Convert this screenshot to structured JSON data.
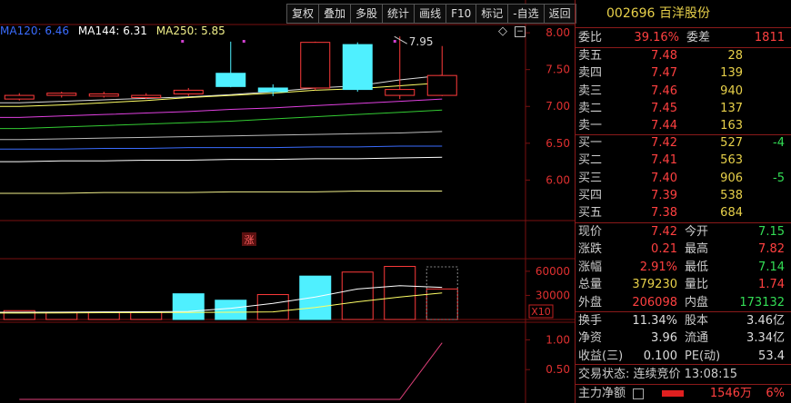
{
  "toolbar": [
    "复权",
    "叠加",
    "多股",
    "统计",
    "画线",
    "F10",
    "标记",
    "-自选",
    "返回"
  ],
  "ma_legend": {
    "ma120": "MA120: 6.46",
    "ma144": "MA144: 6.31",
    "ma250": "MA250: 5.85"
  },
  "colors": {
    "up": "#ff3b3b",
    "down": "#4ff0ff",
    "ma120": "#3a6cff",
    "ma144": "#ffffff",
    "ma250": "#f2f08a",
    "grid": "#7a1010"
  },
  "chart_data": [
    {
      "type": "candlestick",
      "ylim": [
        5.45,
        8.1
      ],
      "y_ticks": [
        "8.00",
        "7.50",
        "7.00",
        "6.50",
        "6.00"
      ],
      "annotations": [
        "7.95",
        "涨"
      ],
      "candles": [
        {
          "o": 7.1,
          "c": 7.15,
          "h": 7.18,
          "l": 7.08
        },
        {
          "o": 7.15,
          "c": 7.18,
          "h": 7.2,
          "l": 7.12
        },
        {
          "o": 7.14,
          "c": 7.17,
          "h": 7.2,
          "l": 7.12
        },
        {
          "o": 7.12,
          "c": 7.15,
          "h": 7.18,
          "l": 7.1
        },
        {
          "o": 7.17,
          "c": 7.22,
          "h": 7.25,
          "l": 7.14
        },
        {
          "o": 7.45,
          "c": 7.27,
          "h": 7.88,
          "l": 7.26
        },
        {
          "o": 7.25,
          "c": 7.2,
          "h": 7.3,
          "l": 7.14
        },
        {
          "o": 7.25,
          "c": 7.87,
          "h": 7.88,
          "l": 7.22
        },
        {
          "o": 7.84,
          "c": 7.23,
          "h": 7.87,
          "l": 7.2
        },
        {
          "o": 7.15,
          "c": 7.23,
          "h": 7.95,
          "l": 7.1
        },
        {
          "o": 7.15,
          "c": 7.42,
          "h": 7.82,
          "l": 7.14
        }
      ],
      "ma_lines": [
        {
          "color": "#d9d9d9",
          "values": [
            7.05,
            7.07,
            7.09,
            7.11,
            7.13,
            7.16,
            7.2,
            7.25,
            7.28,
            7.36,
            7.42
          ]
        },
        {
          "color": "#ffff66",
          "values": [
            7.0,
            7.02,
            7.05,
            7.08,
            7.12,
            7.15,
            7.18,
            7.22,
            7.24,
            7.28,
            7.32
          ]
        },
        {
          "color": "#e040e0",
          "values": [
            6.85,
            6.87,
            6.89,
            6.91,
            6.93,
            6.96,
            6.98,
            7.01,
            7.04,
            7.07,
            7.1
          ]
        },
        {
          "color": "#33cc33",
          "values": [
            6.7,
            6.72,
            6.74,
            6.76,
            6.78,
            6.8,
            6.83,
            6.86,
            6.89,
            6.92,
            6.95
          ]
        },
        {
          "color": "#bbbbbb",
          "values": [
            6.55,
            6.56,
            6.57,
            6.58,
            6.59,
            6.6,
            6.61,
            6.62,
            6.63,
            6.64,
            6.66
          ]
        },
        {
          "color": "#3a6cff",
          "values": [
            6.42,
            6.42,
            6.43,
            6.43,
            6.44,
            6.44,
            6.44,
            6.45,
            6.45,
            6.46,
            6.46
          ]
        },
        {
          "color": "#ffffff",
          "values": [
            6.25,
            6.26,
            6.26,
            6.27,
            6.27,
            6.28,
            6.28,
            6.29,
            6.29,
            6.3,
            6.31
          ]
        },
        {
          "color": "#f2f08a",
          "values": [
            5.82,
            5.82,
            5.83,
            5.83,
            5.83,
            5.84,
            5.84,
            5.84,
            5.85,
            5.85,
            5.85
          ]
        }
      ]
    },
    {
      "type": "bar",
      "ylim": [
        0,
        70000
      ],
      "y_ticks": [
        "60000",
        "30000"
      ],
      "unit_label": "X10",
      "values": [
        11000,
        9000,
        9000,
        9000,
        32000,
        24000,
        31000,
        54000,
        59000,
        66000,
        38000
      ],
      "directions": [
        "up",
        "up",
        "up",
        "up",
        "down",
        "down",
        "up",
        "down",
        "up",
        "up",
        "up"
      ],
      "ma_lines": [
        {
          "color": "#ffffff",
          "values": [
            9000,
            9200,
            9400,
            9600,
            10000,
            14000,
            20000,
            28000,
            38000,
            42000,
            40000
          ]
        },
        {
          "color": "#ffff66",
          "values": [
            8000,
            8200,
            8400,
            8600,
            8800,
            9000,
            9500,
            15000,
            22000,
            28000,
            33000
          ]
        }
      ]
    },
    {
      "type": "line",
      "ylim": [
        0,
        1.25
      ],
      "y_ticks": [
        "1.00",
        "0.50"
      ],
      "values": [
        0,
        0,
        0,
        0,
        0,
        0,
        0,
        0,
        0,
        0,
        0.95
      ]
    }
  ],
  "quote": {
    "code": "002696",
    "name": "百洋股份",
    "weibi_label": "委比",
    "weibi": "39.16%",
    "weicha_label": "委差",
    "weicha": "1811",
    "sells": [
      {
        "label": "卖五",
        "price": "7.48",
        "vol": "28",
        "chg": ""
      },
      {
        "label": "卖四",
        "price": "7.47",
        "vol": "139",
        "chg": ""
      },
      {
        "label": "卖三",
        "price": "7.46",
        "vol": "940",
        "chg": ""
      },
      {
        "label": "卖二",
        "price": "7.45",
        "vol": "137",
        "chg": ""
      },
      {
        "label": "卖一",
        "price": "7.44",
        "vol": "163",
        "chg": ""
      }
    ],
    "buys": [
      {
        "label": "买一",
        "price": "7.42",
        "vol": "527",
        "chg": "-4"
      },
      {
        "label": "买二",
        "price": "7.41",
        "vol": "563",
        "chg": ""
      },
      {
        "label": "买三",
        "price": "7.40",
        "vol": "906",
        "chg": "-5"
      },
      {
        "label": "买四",
        "price": "7.39",
        "vol": "538",
        "chg": ""
      },
      {
        "label": "买五",
        "price": "7.38",
        "vol": "684",
        "chg": ""
      }
    ],
    "stats": [
      {
        "l1": "现价",
        "v1": "7.42",
        "c1": "red",
        "l2": "今开",
        "v2": "7.15",
        "c2": "green"
      },
      {
        "l1": "涨跌",
        "v1": "0.21",
        "c1": "red",
        "l2": "最高",
        "v2": "7.82",
        "c2": "red"
      },
      {
        "l1": "涨幅",
        "v1": "2.91%",
        "c1": "red",
        "l2": "最低",
        "v2": "7.14",
        "c2": "green"
      },
      {
        "l1": "总量",
        "v1": "379230",
        "c1": "yel",
        "l2": "量比",
        "v2": "1.74",
        "c2": "red"
      },
      {
        "l1": "外盘",
        "v1": "206098",
        "c1": "red",
        "l2": "内盘",
        "v2": "173132",
        "c2": "green"
      }
    ],
    "stats2": [
      {
        "l1": "换手",
        "v1": "11.34%",
        "l2": "股本",
        "v2": "3.46亿"
      },
      {
        "l1": "净资",
        "v1": "3.96",
        "l2": "流通",
        "v2": "3.34亿"
      },
      {
        "l1": "收益(三)",
        "v1": "0.100",
        "l2": "PE(动)",
        "v2": "53.4"
      }
    ],
    "trade_status": "交易状态: 连续竞价 13:08:15",
    "main_flow_label": "主力净额",
    "main_flow_value": "1546万",
    "main_flow_pct": "6%",
    "main_flow_fill": 0.06
  }
}
